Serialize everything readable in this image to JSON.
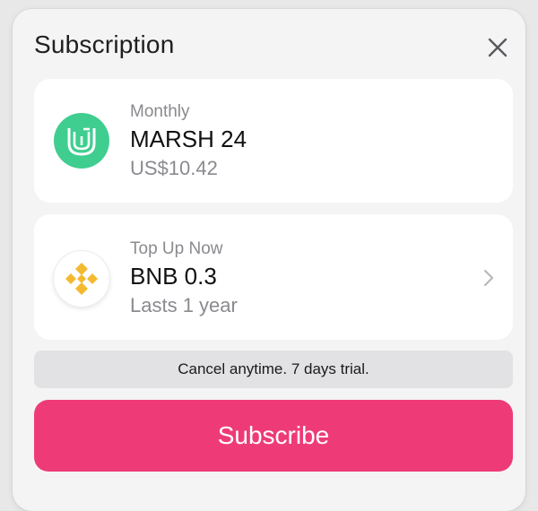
{
  "header": {
    "title": "Subscription",
    "close_icon": "close-icon"
  },
  "plans": {
    "monthly": {
      "label": "Monthly",
      "name": "MARSH 24",
      "price": "US$10.42",
      "icon": "marsh-logo-icon",
      "icon_color": "#3fce8f"
    },
    "topup": {
      "label": "Top Up Now",
      "name": "BNB 0.3",
      "duration": "Lasts 1 year",
      "icon": "bnb-logo-icon",
      "icon_color": "#f3ba2f",
      "chevron_icon": "chevron-right-icon"
    }
  },
  "notice": "Cancel anytime. 7 days trial.",
  "subscribe_button": {
    "label": "Subscribe",
    "color": "#ee3b78"
  }
}
